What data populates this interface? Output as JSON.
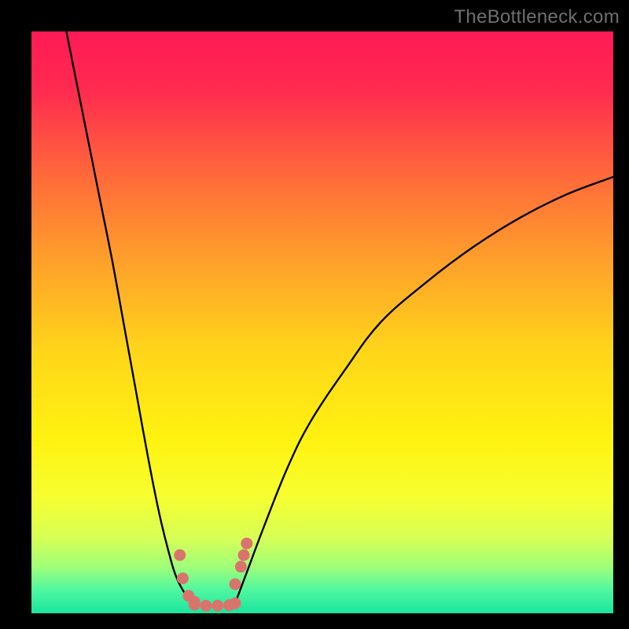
{
  "watermark": "TheBottleneck.com",
  "chart_data": {
    "type": "line",
    "title": "",
    "xlabel": "",
    "ylabel": "",
    "xlim": [
      0,
      100
    ],
    "ylim": [
      0,
      100
    ],
    "grid": false,
    "legend": false,
    "series": [
      {
        "name": "curve-left",
        "x": [
          6,
          8,
          10,
          12,
          14,
          16,
          18,
          20,
          22,
          24,
          25,
          26,
          27,
          28
        ],
        "values": [
          100,
          90,
          80,
          70,
          60,
          49,
          38,
          27,
          17,
          9,
          6,
          4,
          2.5,
          1.5
        ]
      },
      {
        "name": "markers-left",
        "type": "scatter",
        "x": [
          25.5,
          26,
          27,
          28
        ],
        "values": [
          10,
          6,
          3,
          2
        ]
      },
      {
        "name": "valley-floor",
        "type": "scatter",
        "x": [
          28,
          30,
          32,
          34,
          35
        ],
        "values": [
          1.5,
          1.3,
          1.3,
          1.4,
          1.7
        ]
      },
      {
        "name": "markers-right",
        "type": "scatter",
        "x": [
          35,
          36,
          36.5,
          37
        ],
        "values": [
          5,
          8,
          10,
          12
        ]
      },
      {
        "name": "curve-right",
        "x": [
          35,
          37,
          40,
          44,
          48,
          54,
          60,
          68,
          76,
          84,
          92,
          100
        ],
        "values": [
          1.7,
          7,
          15,
          25,
          33,
          42,
          50,
          57,
          63,
          68,
          72,
          75
        ]
      }
    ],
    "gradient_stops": [
      {
        "pos": 0.0,
        "color": "#ff1a55"
      },
      {
        "pos": 0.1,
        "color": "#ff2a50"
      },
      {
        "pos": 0.25,
        "color": "#ff6a3a"
      },
      {
        "pos": 0.4,
        "color": "#ffa22a"
      },
      {
        "pos": 0.55,
        "color": "#ffd61a"
      },
      {
        "pos": 0.7,
        "color": "#fff210"
      },
      {
        "pos": 0.8,
        "color": "#f6ff30"
      },
      {
        "pos": 0.87,
        "color": "#d8ff55"
      },
      {
        "pos": 0.92,
        "color": "#a0ff78"
      },
      {
        "pos": 0.96,
        "color": "#50f7a0"
      },
      {
        "pos": 1.0,
        "color": "#19e59e"
      }
    ],
    "marker_color": "#d9746d",
    "line_color": "#000000"
  }
}
